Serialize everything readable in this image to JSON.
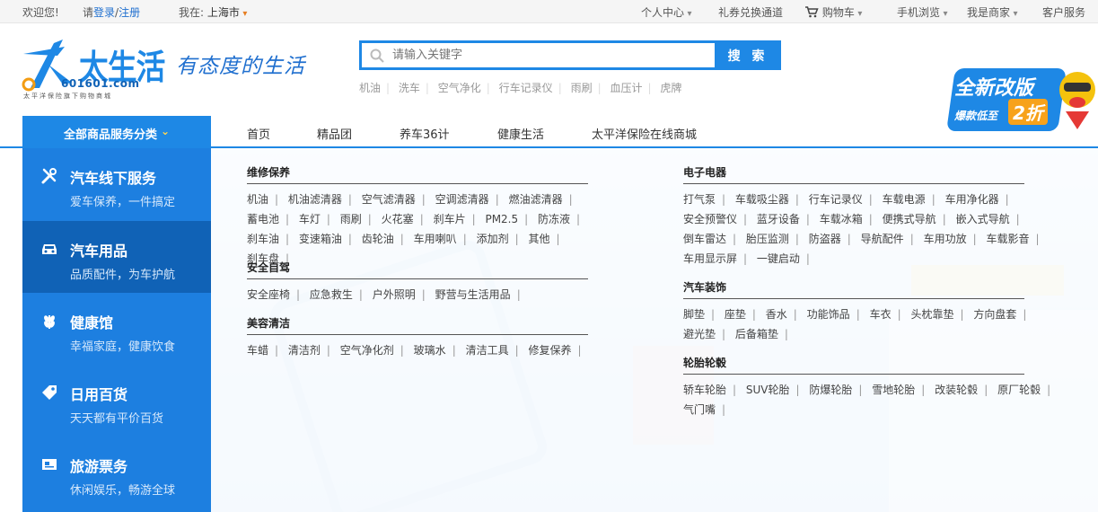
{
  "topbar": {
    "welcome": "欢迎您!",
    "please": "请",
    "login": "登录",
    "slash": "/",
    "register": "注册",
    "location_label": "我在:",
    "location_city": "上海市",
    "personal_center": "个人中心",
    "coupon_exchange": "礼券兑换通道",
    "cart": "购物车",
    "mobile": "手机浏览",
    "merchant": "我是商家",
    "service": "客户服务"
  },
  "header": {
    "logo_text": "太生活",
    "logo_domain": "601601.com",
    "logo_tagline": "太平洋保险旗下购物商城",
    "slogan": "有态度的生活",
    "promo_line1": "全新改版",
    "promo_line2": "爆款低至",
    "promo_number": "2折"
  },
  "search": {
    "placeholder": "请输入关键字",
    "button": "搜 索",
    "hotwords": [
      "机油",
      "洗车",
      "空气净化",
      "行车记录仪",
      "雨刷",
      "血压计",
      "虎牌"
    ]
  },
  "nav": {
    "all_categories": "全部商品服务分类",
    "links": [
      "首页",
      "精品团",
      "养车36计",
      "健康生活",
      "太平洋保险在线商城"
    ]
  },
  "sidebar": {
    "items": [
      {
        "title": "汽车线下服务",
        "sub": "爱车保养，一件搞定"
      },
      {
        "title": "汽车用品",
        "sub": "品质配件，为车护航"
      },
      {
        "title": "健康馆",
        "sub": "幸福家庭，健康饮食"
      },
      {
        "title": "日用百货",
        "sub": "天天都有平价百货"
      },
      {
        "title": "旅游票务",
        "sub": "休闲娱乐，畅游全球"
      }
    ]
  },
  "dropdown": {
    "groups": [
      {
        "title": "维修保养",
        "items": [
          "机油",
          "机油滤清器",
          "空气滤清器",
          "空调滤清器",
          "燃油滤清器",
          "蓄电池",
          "车灯",
          "雨刷",
          "火花塞",
          "刹车片",
          "PM2.5",
          "防冻液",
          "刹车油",
          "变速箱油",
          "齿轮油",
          "车用喇叭",
          "添加剂",
          "其他",
          "刹车盘"
        ]
      },
      {
        "title": "安全自驾",
        "items": [
          "安全座椅",
          "应急救生",
          "户外照明",
          "野营与生活用品"
        ]
      },
      {
        "title": "美容清洁",
        "items": [
          "车蜡",
          "清洁剂",
          "空气净化剂",
          "玻璃水",
          "清洁工具",
          "修复保养"
        ]
      },
      {
        "title": "电子电器",
        "items": [
          "打气泵",
          "车载吸尘器",
          "行车记录仪",
          "车载电源",
          "车用净化器",
          "安全预警仪",
          "蓝牙设备",
          "车载冰箱",
          "便携式导航",
          "嵌入式导航",
          "倒车雷达",
          "胎压监测",
          "防盗器",
          "导航配件",
          "车用功放",
          "车载影音",
          "车用显示屏",
          "一键启动"
        ]
      },
      {
        "title": "汽车装饰",
        "items": [
          "脚垫",
          "座垫",
          "香水",
          "功能饰品",
          "车衣",
          "头枕靠垫",
          "方向盘套",
          "避光垫",
          "后备箱垫"
        ]
      },
      {
        "title": "轮胎轮毂",
        "items": [
          "轿车轮胎",
          "SUV轮胎",
          "防爆轮胎",
          "雪地轮胎",
          "改装轮毂",
          "原厂轮毂",
          "气门嘴"
        ]
      }
    ]
  },
  "colors": {
    "brand_blue": "#1e88e5",
    "sidebar_blue": "#1d7fe0",
    "sidebar_active": "#1062b6",
    "link_blue": "#1f6fcf"
  }
}
